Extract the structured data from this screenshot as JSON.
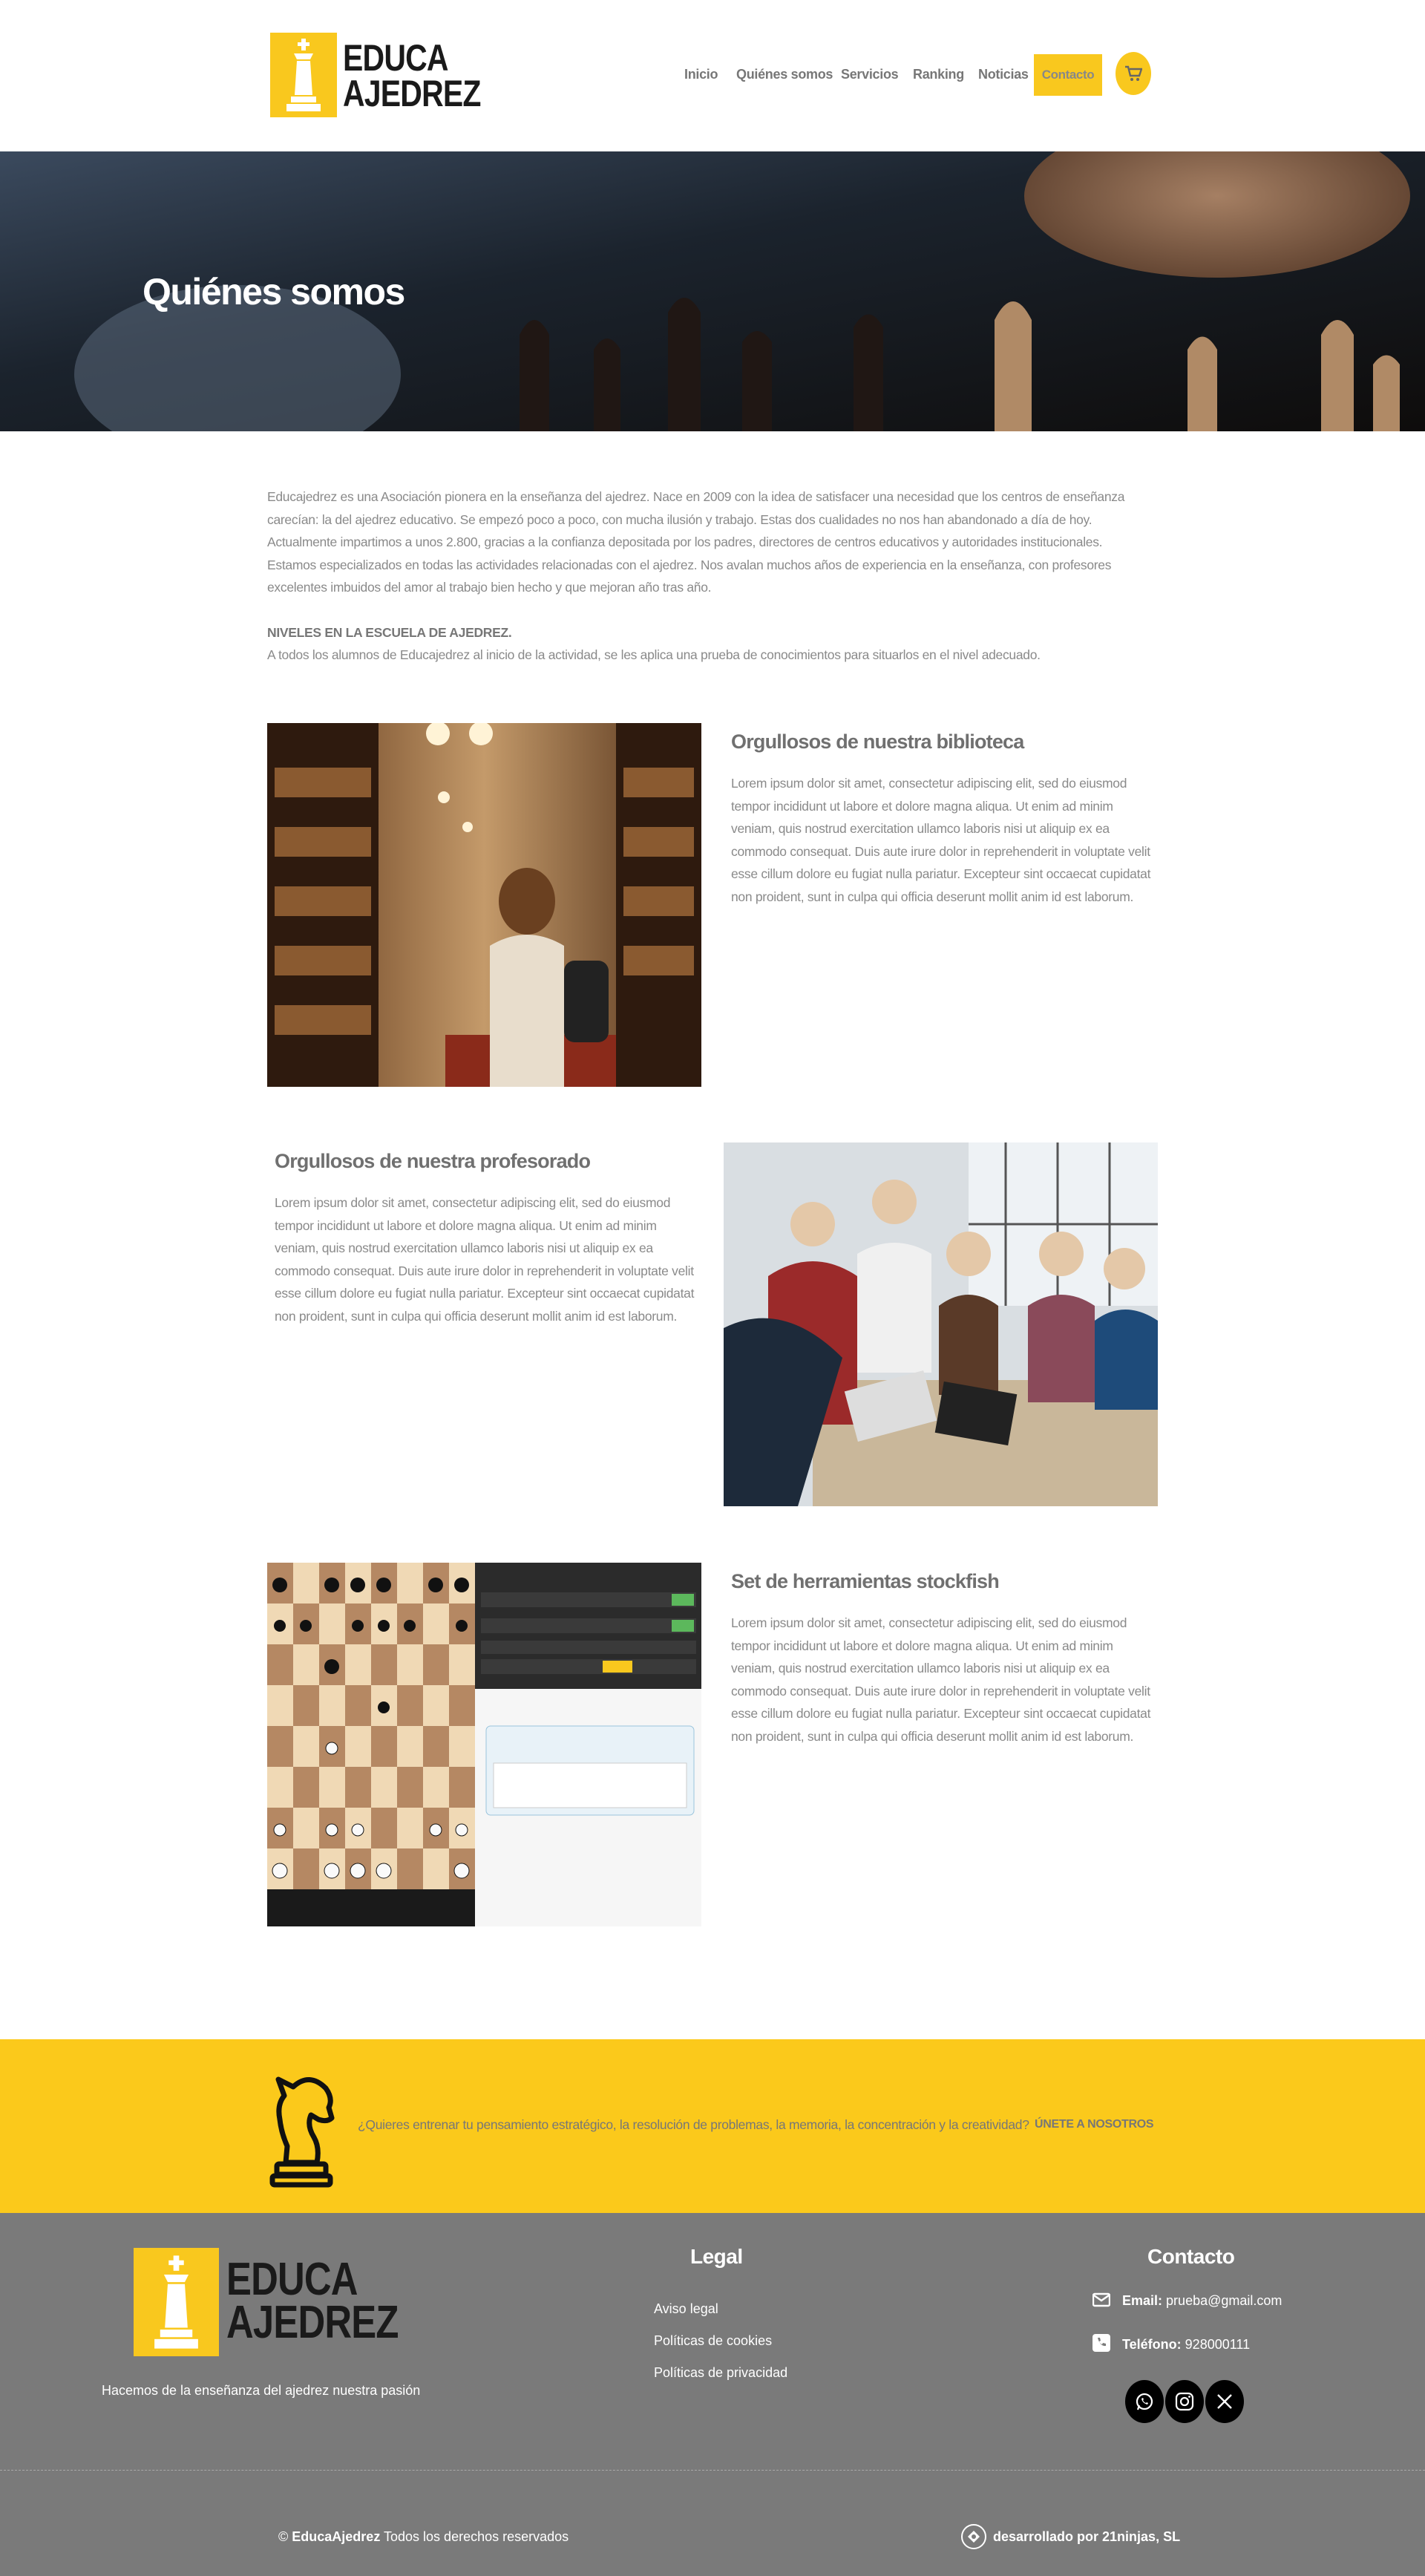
{
  "header": {
    "logo": {
      "line1": "EDUCA",
      "line2": "AJEDREZ"
    },
    "nav": [
      {
        "label": "Inicio"
      },
      {
        "label": "Quiénes somos"
      },
      {
        "label": "Servicios"
      },
      {
        "label": "Ranking"
      },
      {
        "label": "Noticias"
      }
    ],
    "contact_label": "Contacto",
    "cart_icon": "cart-icon"
  },
  "hero": {
    "title": "Quiénes somos"
  },
  "intro": {
    "p1": "Educajedrez es una Asociación pionera en la enseñanza del ajedrez. Nace en 2009 con la idea de satisfacer una necesidad que los centros de enseñanza carecían: la del ajedrez educativo. Se empezó poco a poco, con mucha ilusión y trabajo. Estas dos cualidades no nos han abandonado a día de hoy. Actualmente impartimos a unos 2.800, gracias a la confianza depositada por los padres, directores de centros educativos y autoridades institucionales.",
    "p2": "Estamos especializados en todas las actividades relacionadas con el ajedrez. Nos avalan muchos años de experiencia en la enseñanza, con profesores excelentes imbuidos del amor al trabajo bien hecho y que mejoran año tras año.",
    "levels_title": "NIVELES EN LA ESCUELA DE AJEDREZ.",
    "levels_text": "A todos los alumnos de Educajedrez al inicio de la actividad, se les aplica una prueba de conocimientos para situarlos en el nivel adecuado."
  },
  "sections": [
    {
      "title": "Orgullosos de nuestra biblioteca",
      "body": "Lorem ipsum dolor sit amet, consectetur adipiscing elit, sed do eiusmod tempor incididunt ut labore et dolore magna aliqua. Ut enim ad minim veniam, quis nostrud exercitation ullamco laboris nisi ut aliquip ex ea commodo consequat. Duis aute irure dolor in reprehenderit in voluptate velit esse cillum dolore eu fugiat nulla pariatur. Excepteur sint occaecat cupidatat non proident, sunt in culpa qui officia deserunt mollit anim id est laborum."
    },
    {
      "title": "Orgullosos de nuestra profesorado",
      "body": "Lorem ipsum dolor sit amet, consectetur adipiscing elit, sed do eiusmod tempor incididunt ut labore et dolore magna aliqua. Ut enim ad minim veniam, quis nostrud exercitation ullamco laboris nisi ut aliquip ex ea commodo consequat. Duis aute irure dolor in reprehenderit in voluptate velit esse cillum dolore eu fugiat nulla pariatur. Excepteur sint occaecat cupidatat non proident, sunt in culpa qui officia deserunt mollit anim id est laborum."
    },
    {
      "title": "Set de herramientas stockfish",
      "body": "Lorem ipsum dolor sit amet, consectetur adipiscing elit, sed do eiusmod tempor incididunt ut labore et dolore magna aliqua. Ut enim ad minim veniam, quis nostrud exercitation ullamco laboris nisi ut aliquip ex ea commodo consequat. Duis aute irure dolor in reprehenderit in voluptate velit esse cillum dolore eu fugiat nulla pariatur. Excepteur sint occaecat cupidatat non proident, sunt in culpa qui officia deserunt mollit anim id est laborum."
    }
  ],
  "banner": {
    "text": "¿Quieres entrenar tu pensamiento estratégico, la resolución de problemas, la memoria, la concentración y la creatividad?",
    "cta": "ÚNETE A NOSOTROS",
    "icon": "chess-knight-icon"
  },
  "footer": {
    "tagline": "Hacemos de la enseñanza del ajedrez nuestra pasión",
    "legal_heading": "Legal",
    "legal_links": [
      "Aviso legal",
      "Políticas de cookies",
      "Políticas de privacidad"
    ],
    "contact_heading": "Contacto",
    "email_label": "Email:",
    "email_value": "prueba@gmail.com",
    "phone_label": "Teléfono:",
    "phone_value": "928000111",
    "social_icons": [
      "whatsapp-icon",
      "instagram-icon",
      "x-icon"
    ],
    "copyright_symbol": "©",
    "copyright_brand": "EducaAjedrez",
    "copyright_text": "Todos los derechos reservados",
    "developer": "desarrollado por 21ninjas, SL"
  },
  "colors": {
    "accent": "#f9c81e",
    "footer_bg": "#7a7a7a",
    "text": "#8a8a8a"
  }
}
